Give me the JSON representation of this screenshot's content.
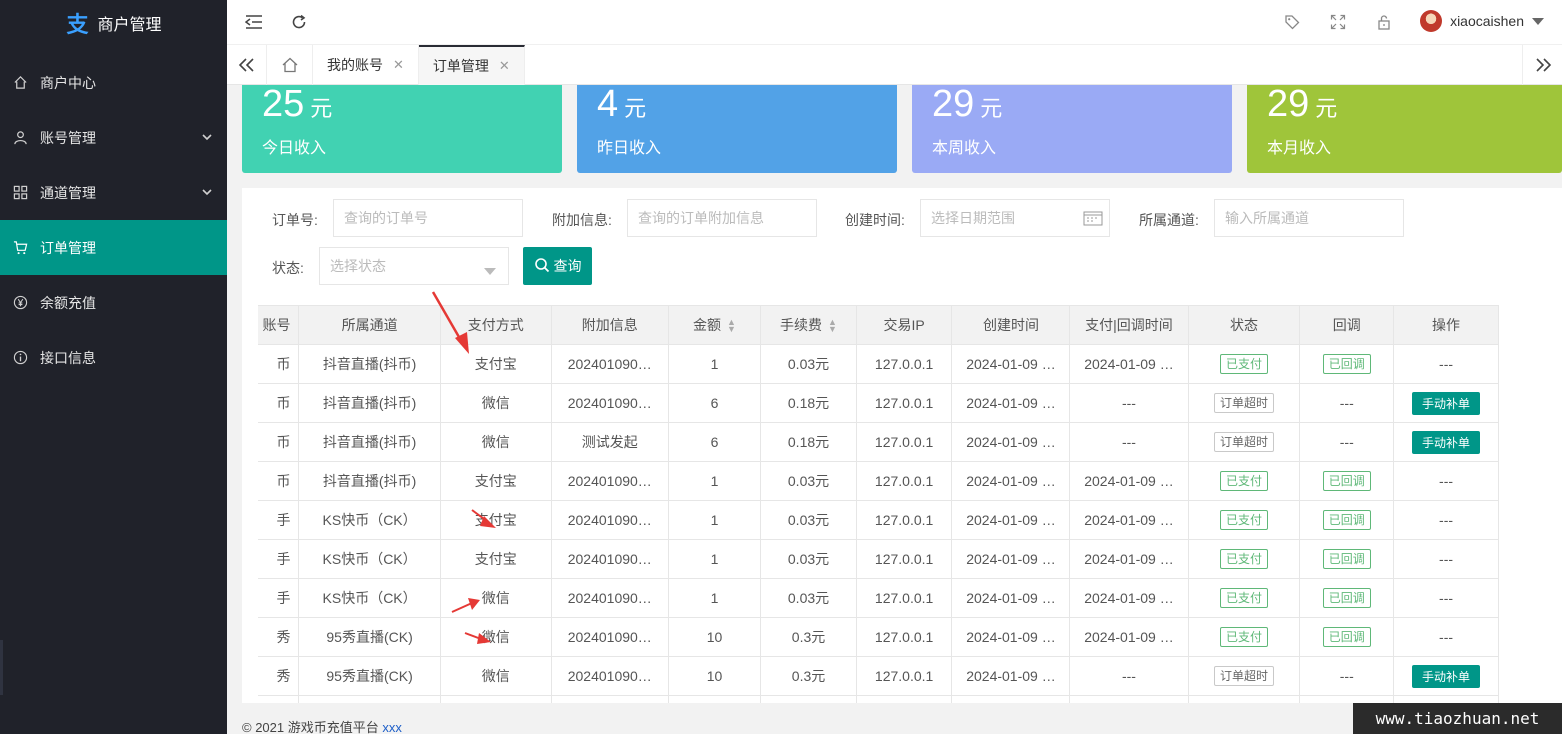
{
  "sidebar": {
    "logo_text": "商户管理",
    "items": [
      {
        "label": "商户中心",
        "icon": "home-icon",
        "has_arrow": false
      },
      {
        "label": "账号管理",
        "icon": "user-icon",
        "has_arrow": true
      },
      {
        "label": "通道管理",
        "icon": "apps-icon",
        "has_arrow": true
      },
      {
        "label": "订单管理",
        "icon": "cart-icon",
        "has_arrow": false,
        "active": true
      },
      {
        "label": "余额充值",
        "icon": "yen-icon",
        "has_arrow": false
      },
      {
        "label": "接口信息",
        "icon": "info-icon",
        "has_arrow": false
      }
    ]
  },
  "header": {
    "username": "xiaocaishen"
  },
  "tabs": {
    "items": [
      {
        "label": "我的账号",
        "active": false
      },
      {
        "label": "订单管理",
        "active": true
      }
    ]
  },
  "stats": [
    {
      "value": "25",
      "unit": "元",
      "label": "今日收入",
      "color": "#41d2b2"
    },
    {
      "value": "4",
      "unit": "元",
      "label": "昨日收入",
      "color": "#52a2e7"
    },
    {
      "value": "29",
      "unit": "元",
      "label": "本周收入",
      "color": "#9aaaf5"
    },
    {
      "value": "29",
      "unit": "元",
      "label": "本月收入",
      "color": "#9fc53a"
    }
  ],
  "filters": {
    "order_no_label": "订单号:",
    "order_no_placeholder": "查询的订单号",
    "extra_label": "附加信息:",
    "extra_placeholder": "查询的订单附加信息",
    "created_label": "创建时间:",
    "created_placeholder": "选择日期范围",
    "channel_label": "所属通道:",
    "channel_placeholder": "输入所属通道",
    "status_label": "状态:",
    "status_placeholder": "选择状态",
    "query_button": "查询"
  },
  "table": {
    "headers": [
      "账号",
      "所属通道",
      "支付方式",
      "附加信息",
      "金额",
      "手续费",
      "交易IP",
      "创建时间",
      "支付|回调时间",
      "状态",
      "回调",
      "操作"
    ],
    "rows": [
      {
        "account": "币",
        "channel": "抖音直播(抖币)",
        "pay": "支付宝",
        "extra": "202401090…",
        "amount": "1",
        "fee": "0.03元",
        "ip": "127.0.0.1",
        "created": "2024-01-09 …",
        "paid": "2024-01-09 …",
        "status": "已支付",
        "callback": "已回调",
        "action": "---"
      },
      {
        "account": "币",
        "channel": "抖音直播(抖币)",
        "pay": "微信",
        "extra": "202401090…",
        "amount": "6",
        "fee": "0.18元",
        "ip": "127.0.0.1",
        "created": "2024-01-09 …",
        "paid": "---",
        "status": "订单超时",
        "callback": "---",
        "action": "手动补单"
      },
      {
        "account": "币",
        "channel": "抖音直播(抖币)",
        "pay": "微信",
        "extra": "测试发起",
        "amount": "6",
        "fee": "0.18元",
        "ip": "127.0.0.1",
        "created": "2024-01-09 …",
        "paid": "---",
        "status": "订单超时",
        "callback": "---",
        "action": "手动补单"
      },
      {
        "account": "币",
        "channel": "抖音直播(抖币)",
        "pay": "支付宝",
        "extra": "202401090…",
        "amount": "1",
        "fee": "0.03元",
        "ip": "127.0.0.1",
        "created": "2024-01-09 …",
        "paid": "2024-01-09 …",
        "status": "已支付",
        "callback": "已回调",
        "action": "---"
      },
      {
        "account": "手",
        "channel": "KS快币（CK）",
        "pay": "支付宝",
        "extra": "202401090…",
        "amount": "1",
        "fee": "0.03元",
        "ip": "127.0.0.1",
        "created": "2024-01-09 …",
        "paid": "2024-01-09 …",
        "status": "已支付",
        "callback": "已回调",
        "action": "---"
      },
      {
        "account": "手",
        "channel": "KS快币（CK）",
        "pay": "支付宝",
        "extra": "202401090…",
        "amount": "1",
        "fee": "0.03元",
        "ip": "127.0.0.1",
        "created": "2024-01-09 …",
        "paid": "2024-01-09 …",
        "status": "已支付",
        "callback": "已回调",
        "action": "---"
      },
      {
        "account": "手",
        "channel": "KS快币（CK）",
        "pay": "微信",
        "extra": "202401090…",
        "amount": "1",
        "fee": "0.03元",
        "ip": "127.0.0.1",
        "created": "2024-01-09 …",
        "paid": "2024-01-09 …",
        "status": "已支付",
        "callback": "已回调",
        "action": "---"
      },
      {
        "account": "秀",
        "channel": "95秀直播(CK)",
        "pay": "微信",
        "extra": "202401090…",
        "amount": "10",
        "fee": "0.3元",
        "ip": "127.0.0.1",
        "created": "2024-01-09 …",
        "paid": "2024-01-09 …",
        "status": "已支付",
        "callback": "已回调",
        "action": "---"
      },
      {
        "account": "秀",
        "channel": "95秀直播(CK)",
        "pay": "微信",
        "extra": "202401090…",
        "amount": "10",
        "fee": "0.3元",
        "ip": "127.0.0.1",
        "created": "2024-01-09 …",
        "paid": "---",
        "status": "订单超时",
        "callback": "---",
        "action": "手动补单"
      },
      {
        "account": "",
        "channel": "",
        "pay": "",
        "extra": "",
        "amount": "",
        "fee": "",
        "ip": "",
        "created": "",
        "paid": "",
        "status": "",
        "callback": "",
        "action": ""
      }
    ]
  },
  "footer": {
    "text": "© 2021 游戏币充值平台",
    "link": "xxx"
  },
  "watermark": "www.tiaozhuan.net",
  "colors": {
    "sidebar_bg": "#20222a",
    "accent": "#009688",
    "paid_green": "#5fb878",
    "arrow_red": "#e53935"
  }
}
